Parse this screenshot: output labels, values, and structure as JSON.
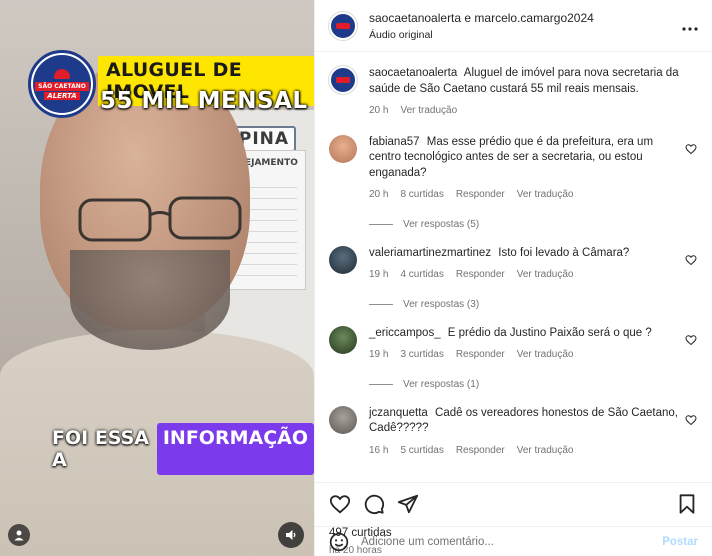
{
  "video": {
    "headline_line1": "ALUGUEL DE IMOVEL",
    "headline_line2": "55 MIL MENSAL",
    "logo_line1": "SÃO CAETANO",
    "logo_line2": "ALERTA",
    "wall_plate": "ALPINA",
    "board_title": "PLANEJAMENTO",
    "caption_plain": "FOI ESSA A",
    "caption_highlight": "INFORMAÇÃO",
    "colors": {
      "headline_bg": "#ffe600",
      "caption_highlight_bg": "#7c3aed",
      "logo_blue": "#1e3a8a",
      "logo_red": "#e11d2a"
    }
  },
  "header": {
    "users": "saocaetanoalerta e marcelo.camargo2024",
    "audio": "Áudio original",
    "more_icon": "more-horizontal-icon"
  },
  "caption_post": {
    "username": "saocaetanoalerta",
    "text": "Aluguel de imóvel para nova secretaria da saúde de São Caetano custará 55 mil reais mensais.",
    "time": "20 h",
    "translate": "Ver tradução"
  },
  "comments": [
    {
      "username": "fabiana57",
      "text": "Mas esse prédio que é da prefeitura, era um centro tecnológico antes de ser a secretaria, ou estou enganada?",
      "time": "20 h",
      "likes": "8 curtidas",
      "reply": "Responder",
      "translate": "Ver tradução",
      "replies": "Ver respostas (5)"
    },
    {
      "username": "valeriamartinezmartinez",
      "text": "Isto foi levado à Câmara?",
      "time": "19 h",
      "likes": "4 curtidas",
      "reply": "Responder",
      "translate": "Ver tradução",
      "replies": "Ver respostas (3)"
    },
    {
      "username": "_ericcampos_",
      "text": "E prédio da Justino Paixão será o que ?",
      "time": "19 h",
      "likes": "3 curtidas",
      "reply": "Responder",
      "translate": "Ver tradução",
      "replies": "Ver respostas (1)"
    },
    {
      "username": "jczanquetta",
      "text": "Cadê os vereadores honestos de São Caetano, Cadê?????",
      "time": "16 h",
      "likes": "5 curtidas",
      "reply": "Responder",
      "translate": "Ver tradução",
      "replies": ""
    }
  ],
  "actions": {
    "likes": "497 curtidas",
    "time": "há 20 horas",
    "icons": [
      "heart-icon",
      "comment-icon",
      "share-icon",
      "bookmark-icon"
    ]
  },
  "add_comment": {
    "placeholder": "Adicione um comentário...",
    "post_label": "Postar"
  }
}
